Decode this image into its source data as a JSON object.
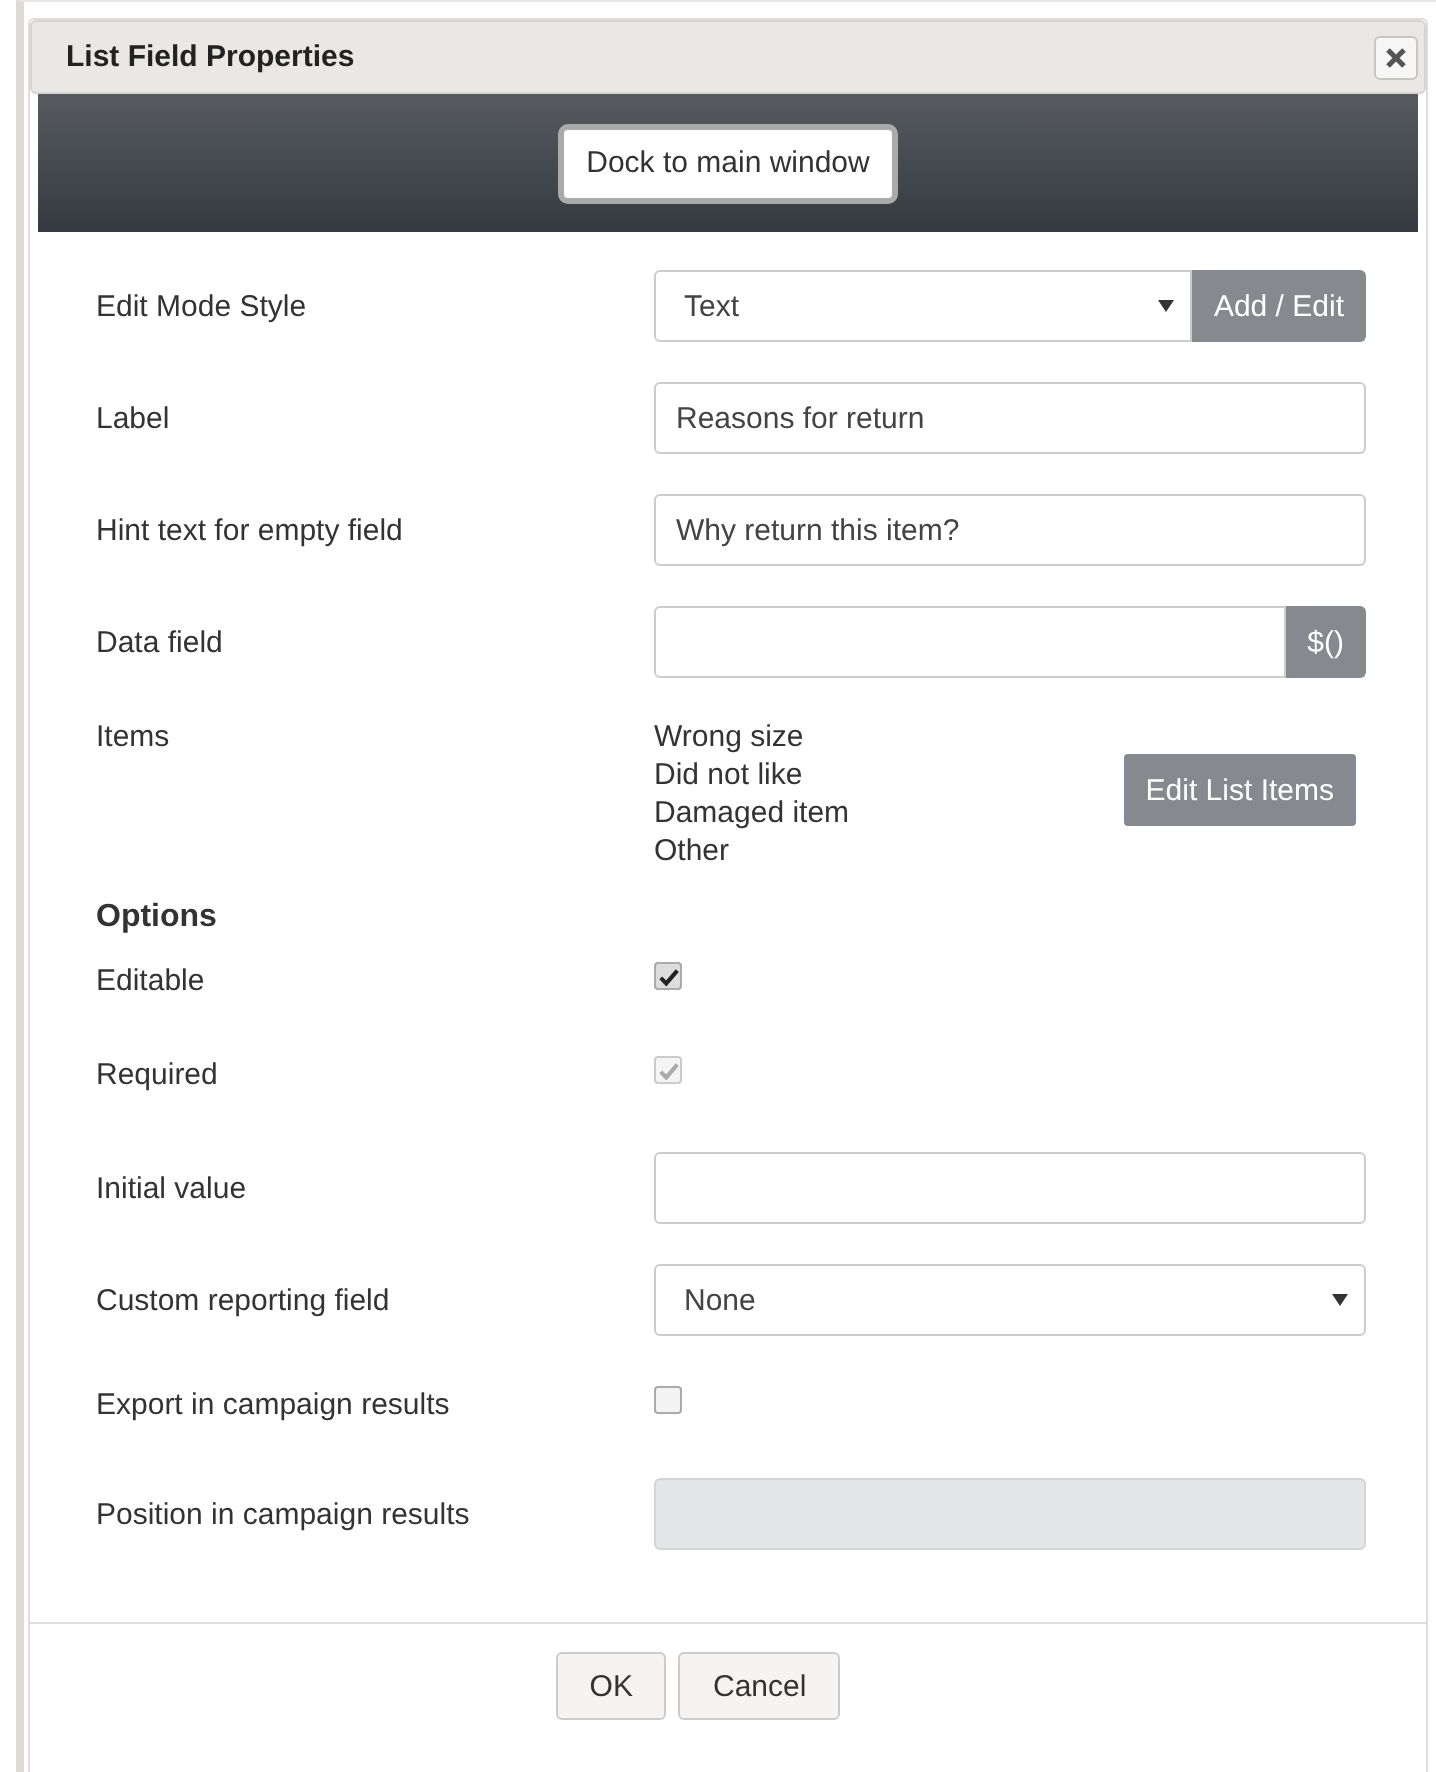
{
  "dialog": {
    "title": "List Field Properties",
    "dock_button": "Dock to main window",
    "rows": [
      {
        "kind": "select",
        "label": "Edit Mode Style",
        "value": "Text",
        "button": "Add / Edit"
      },
      {
        "kind": "text",
        "label": "Label",
        "value": "Reasons for return",
        "disabled": false
      },
      {
        "kind": "text",
        "label": "Hint text for empty field",
        "value": "Why return this item?",
        "disabled": false
      },
      {
        "kind": "text",
        "label": "Data field",
        "button": "$()",
        "disabled": false
      },
      {
        "kind": "items",
        "label": "Items",
        "items": [
          "Wrong size",
          "Did not like",
          "Damaged item",
          "Other"
        ],
        "button": "Edit List Items"
      },
      {
        "kind": "heading",
        "label": "Options"
      },
      {
        "kind": "checkbox",
        "label": "Editable",
        "checked": true,
        "disabled": false
      },
      {
        "kind": "checkbox",
        "label": "Required",
        "checked": true,
        "disabled": true
      },
      {
        "kind": "text",
        "label": "Initial value",
        "disabled": false
      },
      {
        "kind": "select",
        "label": "Custom reporting field",
        "value": "None"
      },
      {
        "kind": "checkbox",
        "label": "Export in campaign results",
        "checked": false,
        "disabled": false
      },
      {
        "kind": "text",
        "label": "Position in campaign results",
        "disabled": true
      }
    ],
    "buttons": [
      "OK",
      "Cancel"
    ]
  }
}
